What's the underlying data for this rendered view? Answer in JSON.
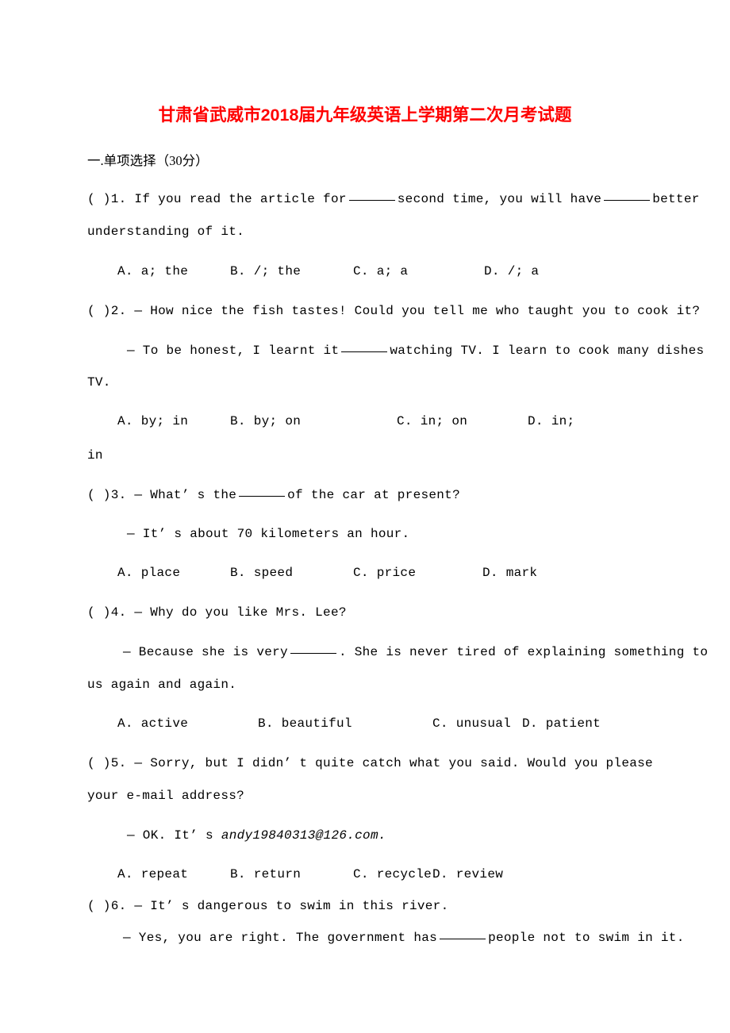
{
  "document": {
    "title": "甘肃省武威市2018届九年级英语上学期第二次月考试题",
    "title_color": "#FF0000",
    "background_color": "#FFFFFF",
    "text_color": "#000000"
  },
  "sections": [
    {
      "heading": "一.单项选择（30分）"
    }
  ],
  "questions": [
    {
      "number": "1",
      "marker": "（  ）",
      "marker_open": "(",
      "marker_close": ")",
      "stem_lines": [
        {
          "segments": [
            {
              "type": "text",
              "value": "1. If you read the article for "
            },
            {
              "type": "blank"
            },
            {
              "type": "text",
              "value": " second time, you will have "
            },
            {
              "type": "blank"
            },
            {
              "type": "text",
              "value": " better"
            }
          ],
          "plain": "1. If you read the article for ______ second time, you will have ______ better"
        },
        {
          "segments": [
            {
              "type": "text",
              "value": "understanding of it."
            }
          ],
          "plain": "understanding of it."
        }
      ],
      "options": [
        {
          "label": "A.",
          "text": "a; the"
        },
        {
          "label": "B.",
          "text": "/; the"
        },
        {
          "label": "C.",
          "text": "a; a"
        },
        {
          "label": "D.",
          "text": "/; a"
        }
      ],
      "options_overflow": ""
    },
    {
      "number": "2",
      "stem_lines": [
        {
          "plain": "2. — How nice the fish tastes! Could you tell me who taught you to cook it?"
        },
        {
          "plain": "— To be honest, I learnt it ______ watching TV. I learn to cook many dishes"
        },
        {
          "plain": "TV."
        }
      ],
      "options": [
        {
          "label": "A.",
          "text": "by; in"
        },
        {
          "label": "B.",
          "text": "by; on"
        },
        {
          "label": "C.",
          "text": "in; on"
        },
        {
          "label": "D.",
          "text": "in;"
        }
      ],
      "options_overflow": "in"
    },
    {
      "number": "3",
      "stem_lines": [
        {
          "plain": "3. — What’ s the ______ of the car at present?"
        },
        {
          "plain": "— It’ s about 70 kilometers an hour."
        }
      ],
      "options": [
        {
          "label": "A.",
          "text": "place"
        },
        {
          "label": "B.",
          "text": "speed"
        },
        {
          "label": "C.",
          "text": "price"
        },
        {
          "label": "D.",
          "text": "mark"
        }
      ],
      "options_overflow": ""
    },
    {
      "number": "4",
      "stem_lines": [
        {
          "plain": "4. — Why do you like Mrs. Lee?"
        },
        {
          "plain": "— Because she is very ______. She is never tired of explaining something to"
        },
        {
          "plain": "us again and again."
        }
      ],
      "options": [
        {
          "label": "A.",
          "text": "active"
        },
        {
          "label": "B.",
          "text": "beautiful"
        },
        {
          "label": "C.",
          "text": "unusual"
        },
        {
          "label": "D.",
          "text": "patient"
        }
      ],
      "options_overflow": ""
    },
    {
      "number": "5",
      "stem_lines": [
        {
          "plain": "5. — Sorry, but I didn’ t quite catch what you said. Would you please"
        },
        {
          "plain": "your e-mail address?"
        },
        {
          "plain": "— OK. It’ s andy19840313@126.com."
        }
      ],
      "email": "andy19840313@126.com.",
      "options": [
        {
          "label": "A.",
          "text": "repeat"
        },
        {
          "label": "B.",
          "text": "return"
        },
        {
          "label": "C.",
          "text": "recycle"
        },
        {
          "label": "D.",
          "text": "review"
        }
      ],
      "options_overflow": ""
    },
    {
      "number": "6",
      "stem_lines": [
        {
          "plain": "6. — It’ s dangerous to swim in this river."
        },
        {
          "plain": "— Yes, you are right. The government has ______ people not to swim in it."
        }
      ],
      "options": [],
      "options_overflow": ""
    }
  ],
  "text": {
    "q1_marker": "(  )",
    "q1_l1_a": "1. If you read the article for",
    "q1_l1_b": "second time, you will have",
    "q1_l1_c": "better",
    "q1_l2": "understanding of it.",
    "q2_marker": "(  )",
    "q2_l1": "2. — How nice the fish tastes! Could you tell me who taught you to cook it?",
    "q2_l2_a": "— To be honest, I learnt it",
    "q2_l2_b": "watching TV. I learn to cook many dishes",
    "q2_l3": "TV.",
    "q2_overflow": "in",
    "q3_marker": "(  )",
    "q3_l1_a": "3. — What’ s the",
    "q3_l1_b": "of the car at present?",
    "q3_l2": "— It’ s about 70 kilometers an hour.",
    "q4_marker": "(  )",
    "q4_l1": "4. — Why do you like Mrs. Lee?",
    "q4_l2_a": "— Because she is very",
    "q4_l2_b": ". She is never tired of explaining something to",
    "q4_l3": "us again and again.",
    "q5_marker": "(  )",
    "q5_l1": "5. — Sorry, but I didn’ t quite catch what you said. Would you please",
    "q5_l2": "your e-mail address?",
    "q5_l3_a": "— OK. It’ s",
    "q5_l3_email": "andy19840313@126.com.",
    "q6_marker": "(  )",
    "q6_l1": "6. — It’ s dangerous to swim in this river.",
    "q6_l2_a": "— Yes, you are right. The government has",
    "q6_l2_b": "people not to swim in it."
  }
}
